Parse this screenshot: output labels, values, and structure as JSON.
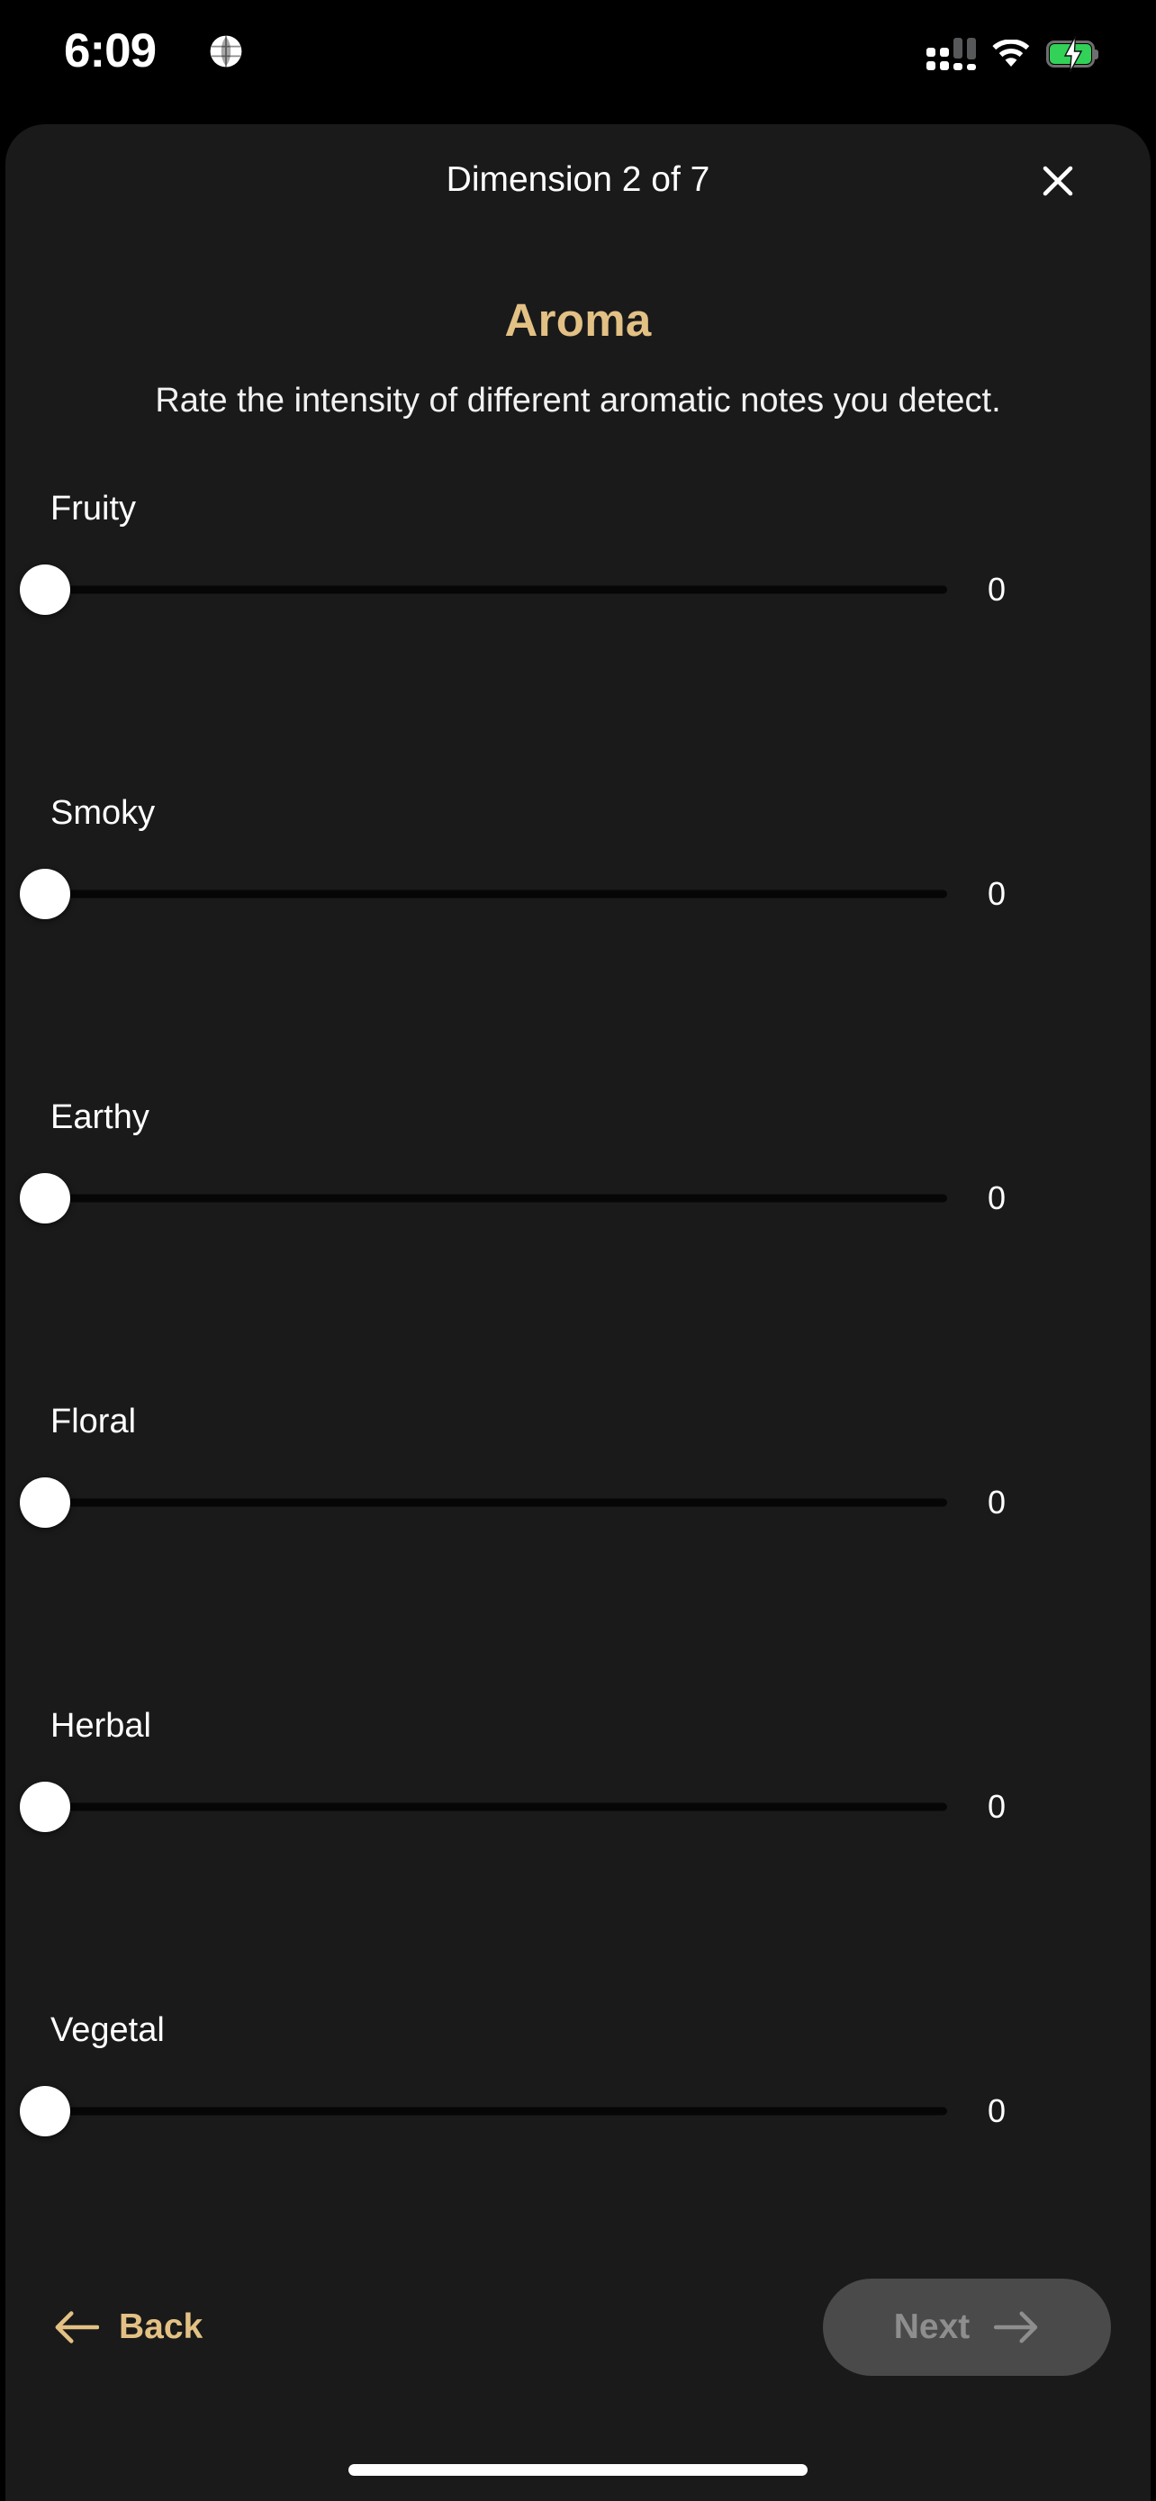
{
  "status_bar": {
    "time": "6:09",
    "globe_icon": "globe-icon",
    "signal_icon": "cellular-signal-icon",
    "wifi_icon": "wifi-icon",
    "battery_icon": "battery-charging-icon",
    "battery_color": "#32d158",
    "signal_bars": [
      1,
      1,
      0,
      0
    ]
  },
  "header": {
    "dimension_indicator": "Dimension 2 of 7",
    "close_icon": "close-icon"
  },
  "page": {
    "title": "Aroma",
    "title_color": "#e3c184",
    "subtitle": "Rate the intensity of different aromatic notes you detect."
  },
  "sliders": [
    {
      "label": "Fruity",
      "value": "0",
      "percent": 0,
      "min": 0,
      "max": 10
    },
    {
      "label": "Smoky",
      "value": "0",
      "percent": 0,
      "min": 0,
      "max": 10
    },
    {
      "label": "Earthy",
      "value": "0",
      "percent": 0,
      "min": 0,
      "max": 10
    },
    {
      "label": "Floral",
      "value": "0",
      "percent": 0,
      "min": 0,
      "max": 10
    },
    {
      "label": "Herbal",
      "value": "0",
      "percent": 0,
      "min": 0,
      "max": 10
    },
    {
      "label": "Vegetal",
      "value": "0",
      "percent": 0,
      "min": 0,
      "max": 10
    }
  ],
  "footer": {
    "back_label": "Back",
    "back_icon": "arrow-left-icon",
    "back_color": "#e3c184",
    "next_label": "Next",
    "next_icon": "arrow-right-icon",
    "next_enabled": false,
    "next_bg_color": "#4a4a4a",
    "next_text_color": "#8e8e8e"
  }
}
